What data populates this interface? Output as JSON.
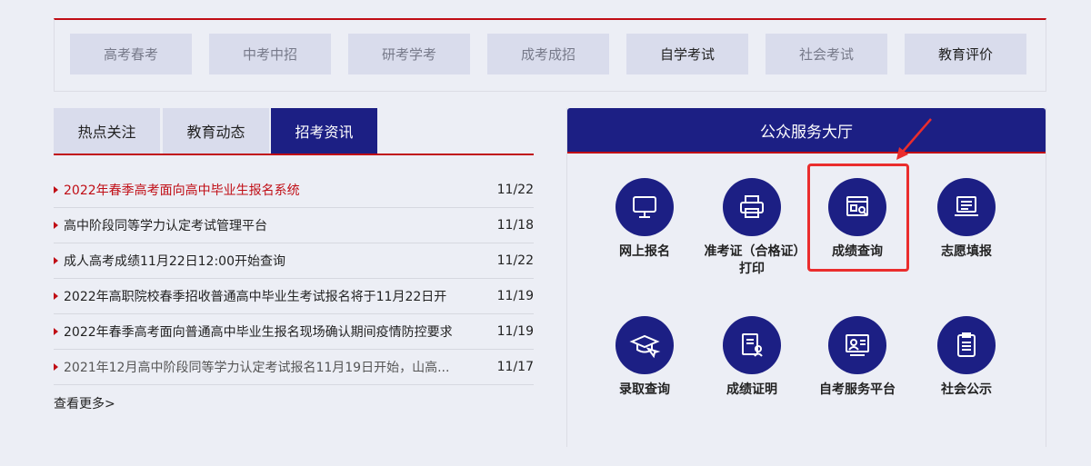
{
  "categories": [
    "高考春考",
    "中考中招",
    "研考学考",
    "成考成招",
    "自学考试",
    "社会考试",
    "教育评价"
  ],
  "tabs": [
    "热点关注",
    "教育动态",
    "招考资讯"
  ],
  "news": [
    {
      "title": "2022年春季高考面向高中毕业生报名系统",
      "date": "11/22"
    },
    {
      "title": "高中阶段同等学力认定考试管理平台",
      "date": "11/18"
    },
    {
      "title": "成人高考成绩11月22日12:00开始查询",
      "date": "11/22"
    },
    {
      "title": "2022年高职院校春季招收普通高中毕业生考试报名将于11月22日开",
      "date": "11/19"
    },
    {
      "title": "2022年春季高考面向普通高中毕业生报名现场确认期间疫情防控要求",
      "date": "11/19"
    },
    {
      "title": "2021年12月高中阶段同等学力认定考试报名11月19日开始，山高...",
      "date": "11/17"
    }
  ],
  "more": "查看更多>",
  "service": {
    "title": "公众服务大厅",
    "items": [
      {
        "label": "网上报名",
        "icon": "monitor-icon"
      },
      {
        "label": "准考证（合格证）打印",
        "icon": "printer-icon"
      },
      {
        "label": "成绩查询",
        "icon": "score-search-icon"
      },
      {
        "label": "志愿填报",
        "icon": "laptop-list-icon"
      },
      {
        "label": "录取查询",
        "icon": "graduation-cap-icon"
      },
      {
        "label": "成绩证明",
        "icon": "certificate-icon"
      },
      {
        "label": "自考服务平台",
        "icon": "platform-icon"
      },
      {
        "label": "社会公示",
        "icon": "clipboard-icon"
      }
    ]
  },
  "colors": {
    "primary": "#1c1f84",
    "accent": "#c00d15",
    "highlight": "#ea2d2d"
  }
}
